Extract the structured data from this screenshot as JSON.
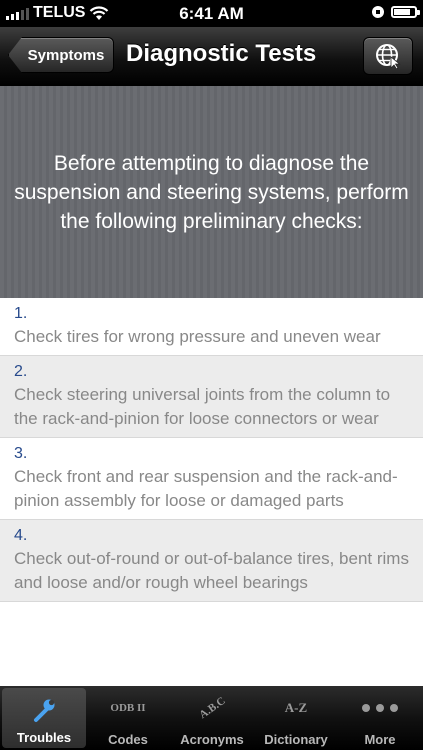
{
  "status_bar": {
    "carrier": "TELUS",
    "time": "6:41 AM",
    "signal_bars": 3,
    "battery_level": 0.8
  },
  "nav": {
    "back_label": "Symptoms",
    "title": "Diagnostic Tests",
    "action_icon": "globe-icon"
  },
  "header": {
    "text": "Before attempting to diagnose the suspension and steering systems, perform the following preliminary checks:"
  },
  "checks": [
    {
      "number": "1.",
      "text": "Check tires for wrong pressure and uneven wear"
    },
    {
      "number": "2.",
      "text": "Check steering universal joints from the column to the rack-and-pinion for loose connectors or wear"
    },
    {
      "number": "3.",
      "text": "Check front and rear suspension and the rack-and-pinion assembly for loose or damaged parts"
    },
    {
      "number": "4.",
      "text": "Check out-of-round or out-of-balance tires, bent rims and loose and/or rough wheel bearings"
    }
  ],
  "tabs": [
    {
      "label": "Troubles",
      "icon": "wrench-icon",
      "active": true
    },
    {
      "label": "Codes",
      "icon": "obd-ii-icon",
      "icon_text": "ODB II",
      "active": false
    },
    {
      "label": "Acronyms",
      "icon": "abc-icon",
      "icon_text": "A.B.C",
      "active": false
    },
    {
      "label": "Dictionary",
      "icon": "a-z-icon",
      "icon_text": "A-Z",
      "active": false
    },
    {
      "label": "More",
      "icon": "more-dots-icon",
      "active": false
    }
  ]
}
